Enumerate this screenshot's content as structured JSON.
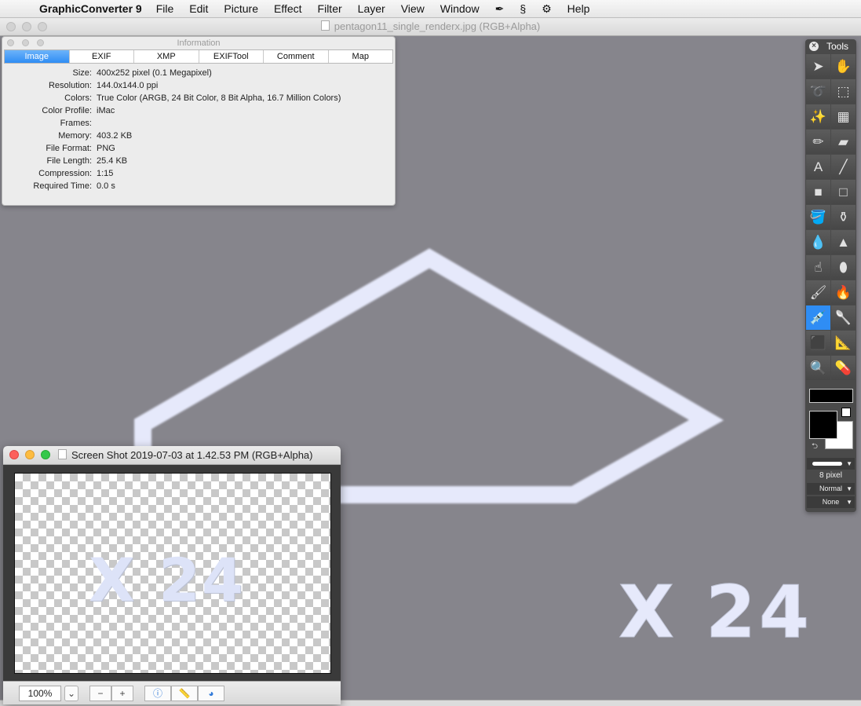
{
  "menubar": {
    "app_name": "GraphicConverter 9",
    "items": [
      "File",
      "Edit",
      "Picture",
      "Effect",
      "Filter",
      "Layer",
      "View",
      "Window",
      "Help"
    ],
    "icons": [
      "apple-icon",
      "eyedropper-menu-icon",
      "script-menu-icon",
      "gear-icon"
    ]
  },
  "document": {
    "title": "pentagon11_single_renderx.jpg (RGB+Alpha)",
    "canvas_text": "X 24",
    "background_color": "#86858c",
    "outline_color": "#e6e9fb"
  },
  "info_panel": {
    "title": "Information",
    "tabs": [
      "Image",
      "EXIF",
      "XMP",
      "EXIFTool",
      "Comment",
      "Map"
    ],
    "active_tab": "Image",
    "rows": [
      {
        "label": "Size:",
        "value": "400x252 pixel (0.1 Megapixel)"
      },
      {
        "label": "Resolution:",
        "value": "144.0x144.0 ppi"
      },
      {
        "label": "Colors:",
        "value": "True Color (ARGB, 24 Bit Color, 8 Bit Alpha, 16.7 Million Colors)"
      },
      {
        "label": "Color Profile:",
        "value": "iMac"
      },
      {
        "label": "Frames:",
        "value": ""
      },
      {
        "label": "Memory:",
        "value": "403.2 KB"
      },
      {
        "label": "File Format:",
        "value": "PNG"
      },
      {
        "label": "File Length:",
        "value": "25.4 KB"
      },
      {
        "label": "Compression:",
        "value": "1:15"
      },
      {
        "label": "Required Time:",
        "value": "0.0 s"
      }
    ]
  },
  "tools_palette": {
    "title": "Tools",
    "tools": [
      {
        "name": "arrow-tool",
        "glyph": "➤"
      },
      {
        "name": "hand-tool",
        "glyph": "✋"
      },
      {
        "name": "lasso-tool",
        "glyph": "➰"
      },
      {
        "name": "marquee-tool",
        "glyph": "⬚"
      },
      {
        "name": "magic-wand-tool",
        "glyph": "✨"
      },
      {
        "name": "pattern-wand-tool",
        "glyph": "▦"
      },
      {
        "name": "pencil-tool",
        "glyph": "✏"
      },
      {
        "name": "eraser-tool",
        "glyph": "▰"
      },
      {
        "name": "text-tool",
        "glyph": "A"
      },
      {
        "name": "line-tool",
        "glyph": "╱"
      },
      {
        "name": "filled-rect-tool",
        "glyph": "■"
      },
      {
        "name": "rect-tool",
        "glyph": "□"
      },
      {
        "name": "paint-bucket-tool",
        "glyph": "🪣"
      },
      {
        "name": "stamp-tool",
        "glyph": "⚱"
      },
      {
        "name": "blur-drop-tool",
        "glyph": "💧"
      },
      {
        "name": "sharpen-cone-tool",
        "glyph": "▲"
      },
      {
        "name": "smudge-finger-tool",
        "glyph": "☝"
      },
      {
        "name": "sponge-tool",
        "glyph": "⬮"
      },
      {
        "name": "brush-tool",
        "glyph": "🖌"
      },
      {
        "name": "burn-brush-tool",
        "glyph": "🔥"
      },
      {
        "name": "eyedropper-tool",
        "glyph": "💉"
      },
      {
        "name": "spoon-tool",
        "glyph": "🥄"
      },
      {
        "name": "crop-tool",
        "glyph": "⬛"
      },
      {
        "name": "caliper-tool",
        "glyph": "📐"
      },
      {
        "name": "zoom-tool",
        "glyph": "🔍"
      },
      {
        "name": "syringe-tool",
        "glyph": "💊"
      }
    ],
    "active_tool": "eyedropper-tool",
    "pen_size": "8 pixel",
    "blend_mode": "Normal",
    "none_option": "None",
    "foreground_color": "#000000",
    "background_color": "#ffffff"
  },
  "screenshot_window": {
    "title": "Screen Shot 2019-07-03 at 1.42.53 PM (RGB+Alpha)",
    "canvas_text": "X 24",
    "zoom": "100%",
    "zoom_out": "−",
    "zoom_in": "+",
    "info_glyph": "ⓘ",
    "ruler_glyph": "📏",
    "color_glyph": "◕"
  }
}
